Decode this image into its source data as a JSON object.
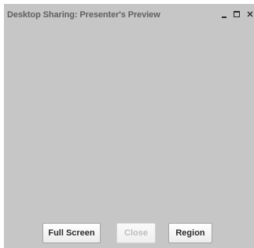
{
  "window": {
    "title": "Desktop Sharing: Presenter's Preview"
  },
  "title_controls": {
    "minimize_icon": "minimize-icon",
    "maximize_icon": "maximize-icon",
    "close_icon": "close-x-icon"
  },
  "buttons": {
    "full_screen": "Full Screen",
    "close": "Close",
    "region": "Region"
  },
  "state": {
    "close_enabled": false
  },
  "colors": {
    "window_background": "#c6c6c6",
    "title_text": "#5f5f5f",
    "disabled_text": "#bdbdbd"
  }
}
